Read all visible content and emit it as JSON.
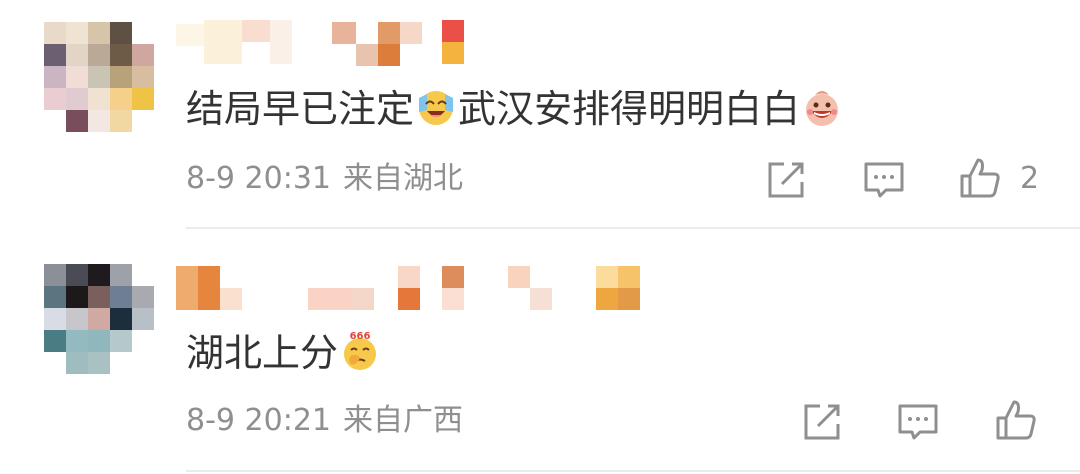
{
  "comments": [
    {
      "text_before_emoji": "结局早已注定",
      "emoji_1": "laugh-cry-icon",
      "text_after_emoji": "武汉安排得明明白白",
      "emoji_2": "grinning-face-icon",
      "date": "8-9 20:31",
      "location": "来自湖北",
      "like_count": "2"
    },
    {
      "text": "湖北上分",
      "emoji": "666-thinking-icon",
      "date": "8-9 20:21",
      "location": "来自广西",
      "like_count": ""
    }
  ],
  "icons": {
    "share": "share-icon",
    "reply": "comment-icon",
    "like": "thumbs-up-icon"
  },
  "colors": {
    "text": "#333333",
    "meta": "#8f8f8f",
    "divider": "#ebebeb"
  }
}
